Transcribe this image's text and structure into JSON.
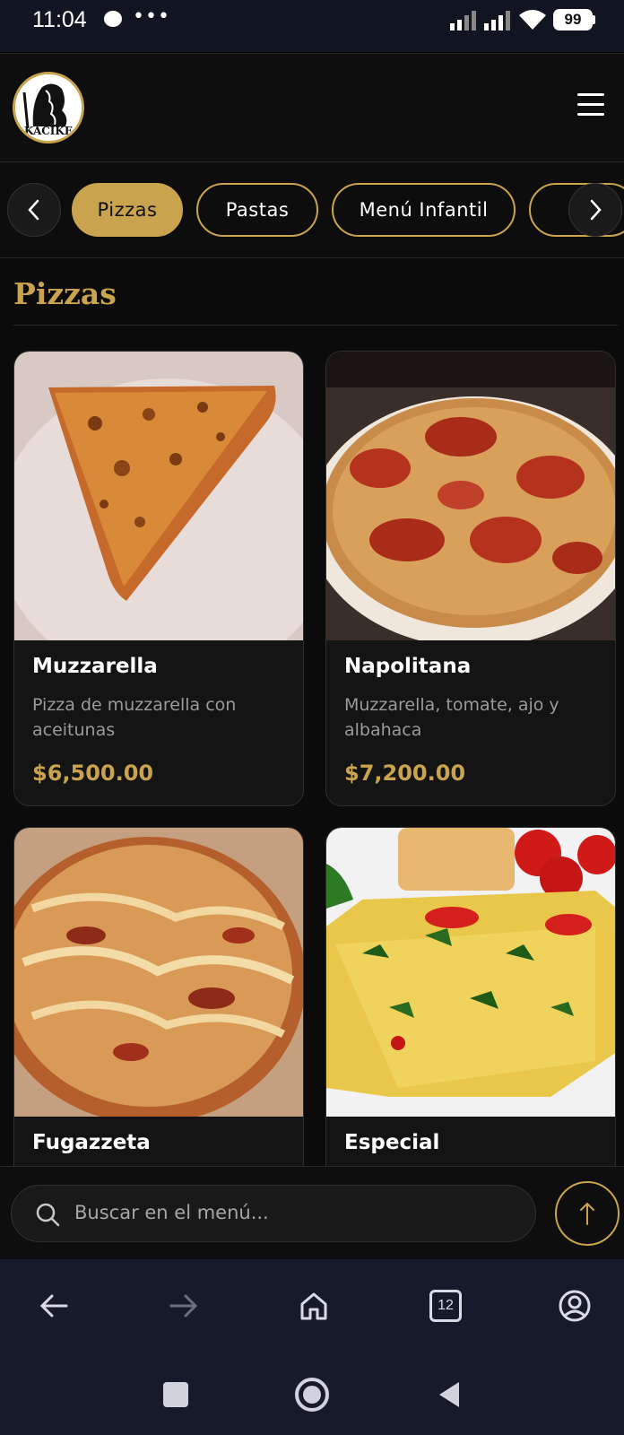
{
  "status_bar": {
    "time": "11:04",
    "battery": "99"
  },
  "header": {
    "logo_text": "KACIKE"
  },
  "categories": [
    "Pizzas",
    "Pastas",
    "Menú Infantil"
  ],
  "section": {
    "title": "Pizzas"
  },
  "items": [
    {
      "name": "Muzzarella",
      "description": "Pizza de muzzarella con aceitunas",
      "price": "$6,500.00"
    },
    {
      "name": "Napolitana",
      "description": "Muzzarella, tomate, ajo y albahaca",
      "price": "$7,200.00"
    },
    {
      "name": "Fugazzeta"
    },
    {
      "name": "Especial"
    }
  ],
  "search": {
    "placeholder": "Buscar en el menú..."
  },
  "browser": {
    "tab_count": "12"
  },
  "colors": {
    "accent": "#c9a34e",
    "background": "#0b0b0b",
    "card": "#141414"
  },
  "icons": {
    "status": [
      "message-icon",
      "more-dots-icon",
      "signal-icon",
      "wifi-icon",
      "battery-icon"
    ],
    "nav": [
      "chevron-left-icon",
      "chevron-right-icon",
      "hamburger-menu-icon",
      "search-icon",
      "arrow-up-icon"
    ],
    "browser": [
      "back-arrow-icon",
      "forward-arrow-icon",
      "home-icon",
      "tabs-icon",
      "profile-icon"
    ],
    "system": [
      "recents-square-icon",
      "home-circle-icon",
      "back-triangle-icon"
    ]
  }
}
